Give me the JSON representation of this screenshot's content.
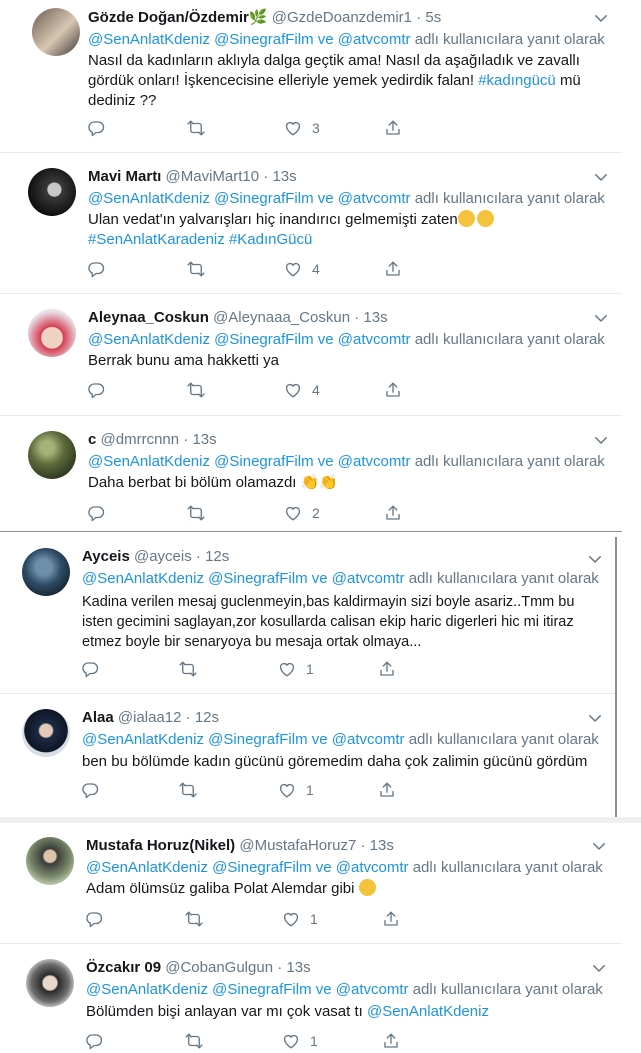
{
  "reply_prefix": "adlı kullanıcılara yanıt olarak",
  "reply_targets": [
    "@SenAnlatKdeniz",
    "@SinegrafFilm",
    "ve",
    "@atvcomtr"
  ],
  "tweets": [
    {
      "name": "Gözde Doğan/Özdemir",
      "handle": "@GzdeDoanzdemir1",
      "time": "5s",
      "lines": [
        "Nasıl da kadınların aklıyla dalga geçtik ama! Nasıl da aşağıladık ve zavallı",
        "gördük onları! İşkencecisine elleriyle yemek yedirdik falan!",
        "dediniz ??"
      ],
      "hashtag": "#kadıngücü",
      "hashtag_after": "mü",
      "likes": "3"
    },
    {
      "name": "Mavi Martı",
      "handle": "@MaviMart10",
      "time": "13s",
      "lines": [
        "Ulan vedat'ın yalvarışları hiç inandırıcı gelmemişti zaten"
      ],
      "hashtags": [
        "#SenAnlatKaradeniz",
        "#KadınGücü"
      ],
      "likes": "4"
    },
    {
      "name": "Aleynaa_Coskun",
      "handle": "@Aleynaaa_Coskun",
      "time": "13s",
      "lines": [
        "Berrak bunu ama hakketti ya"
      ],
      "likes": "4"
    },
    {
      "name": "c",
      "handle": "@dmrrcnnn",
      "time": "13s",
      "lines": [
        "Daha berbat bi bölüm olamazdı"
      ],
      "likes": "2"
    },
    {
      "name": "Ayceis",
      "handle": "@ayceis",
      "time": "12s",
      "lines": [
        "Kadina verilen mesaj guclenmeyin,bas kaldirmayin sizi boyle asariz..Tmm bu",
        "isten gecimini saglayan,zor kosullarda calisan ekip haric digerleri hic mi itiraz",
        "etmez boyle bir senaryoya bu mesaja ortak olmaya..."
      ],
      "likes": "1"
    },
    {
      "name": "Alaa",
      "handle": "@ialaa12",
      "time": "12s",
      "lines": [
        "ben bu bölümde kadın gücünü göremedim daha çok zalimin gücünü gördüm"
      ],
      "likes": "1"
    },
    {
      "name": "Mustafa Horuz(Nikel)",
      "handle": "@MustafaHoruz7",
      "time": "13s",
      "lines": [
        "Adam ölümsüz galiba Polat Alemdar gibi"
      ],
      "likes": "1"
    },
    {
      "name": "Özcakır 09",
      "handle": "@CobanGulgun",
      "time": "13s",
      "lines": [
        "Bölümden bişi anlayan var mı çok vasat tı"
      ],
      "mention_after": "@SenAnlatKdeniz",
      "likes": "1"
    }
  ],
  "colors": {
    "link": "#1b95e0",
    "muted": "#657786",
    "text": "#14171a",
    "divider": "#e6ecf0"
  },
  "icons": [
    "reply-icon",
    "retweet-icon",
    "like-icon",
    "share-icon",
    "chevron-down-icon"
  ]
}
